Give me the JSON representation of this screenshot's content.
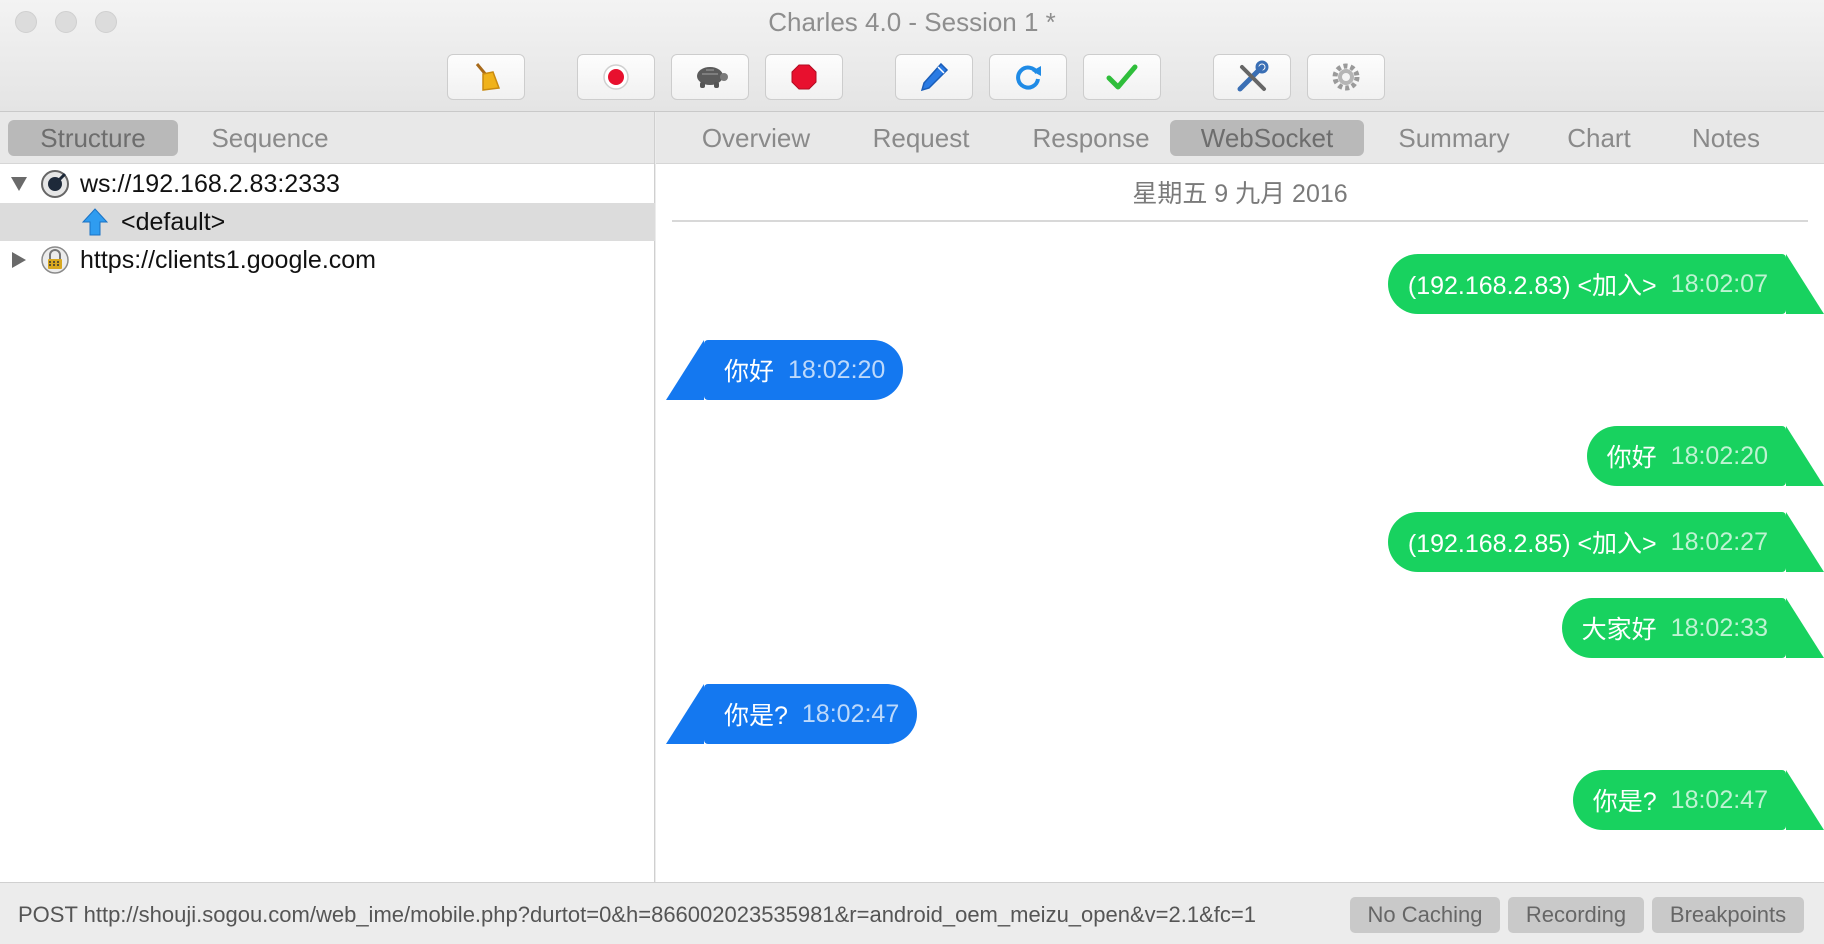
{
  "window": {
    "title": "Charles 4.0 - Session 1 *"
  },
  "toolbar": {
    "buttons": [
      {
        "name": "broom-icon"
      },
      {
        "name": "record-icon",
        "color": "#e8102e"
      },
      {
        "name": "turtle-icon"
      },
      {
        "name": "stop-sign-icon",
        "color": "#e8102e"
      },
      {
        "name": "pen-icon",
        "color": "#2a7be4"
      },
      {
        "name": "refresh-icon",
        "color": "#1f8be6"
      },
      {
        "name": "checkmark-icon",
        "color": "#2fbe3b"
      },
      {
        "name": "tools-icon"
      },
      {
        "name": "gear-icon"
      }
    ]
  },
  "left_tabs": [
    {
      "label": "Structure",
      "active": true
    },
    {
      "label": "Sequence",
      "active": false
    }
  ],
  "tree": [
    {
      "label": "ws://192.168.2.83:2333",
      "expanded": true,
      "icon": "websocket-globe-icon",
      "level": 0
    },
    {
      "label": "<default>",
      "icon": "upload-arrow-icon",
      "level": 1,
      "selected": true
    },
    {
      "label": "https://clients1.google.com",
      "expanded": false,
      "icon": "lock-icon",
      "level": 0
    }
  ],
  "right_tabs": [
    {
      "label": "Overview",
      "active": false
    },
    {
      "label": "Request",
      "active": false
    },
    {
      "label": "Response",
      "active": false
    },
    {
      "label": "WebSocket",
      "active": true
    },
    {
      "label": "Summary",
      "active": false
    },
    {
      "label": "Chart",
      "active": false
    },
    {
      "label": "Notes",
      "active": false
    }
  ],
  "websocket": {
    "date": "星期五 9 九月 2016",
    "messages": [
      {
        "direction": "out",
        "text": "(192.168.2.83) <加入>",
        "time": "18:02:07"
      },
      {
        "direction": "in",
        "text": "你好",
        "time": "18:02:20"
      },
      {
        "direction": "out",
        "text": "你好",
        "time": "18:02:20"
      },
      {
        "direction": "out",
        "text": "(192.168.2.85) <加入>",
        "time": "18:02:27"
      },
      {
        "direction": "out",
        "text": "大家好",
        "time": "18:02:33"
      },
      {
        "direction": "in",
        "text": "你是?",
        "time": "18:02:47"
      },
      {
        "direction": "out",
        "text": "你是?",
        "time": "18:02:47"
      }
    ],
    "colors": {
      "outgoing": "#18d25f",
      "incoming": "#1478f0"
    }
  },
  "status": {
    "url": "POST http://shouji.sogou.com/web_ime/mobile.php?durtot=0&h=866002023535981&r=android_oem_meizu_open&v=2.1&fc=1",
    "buttons": [
      {
        "label": "No Caching"
      },
      {
        "label": "Recording"
      },
      {
        "label": "Breakpoints"
      }
    ]
  }
}
